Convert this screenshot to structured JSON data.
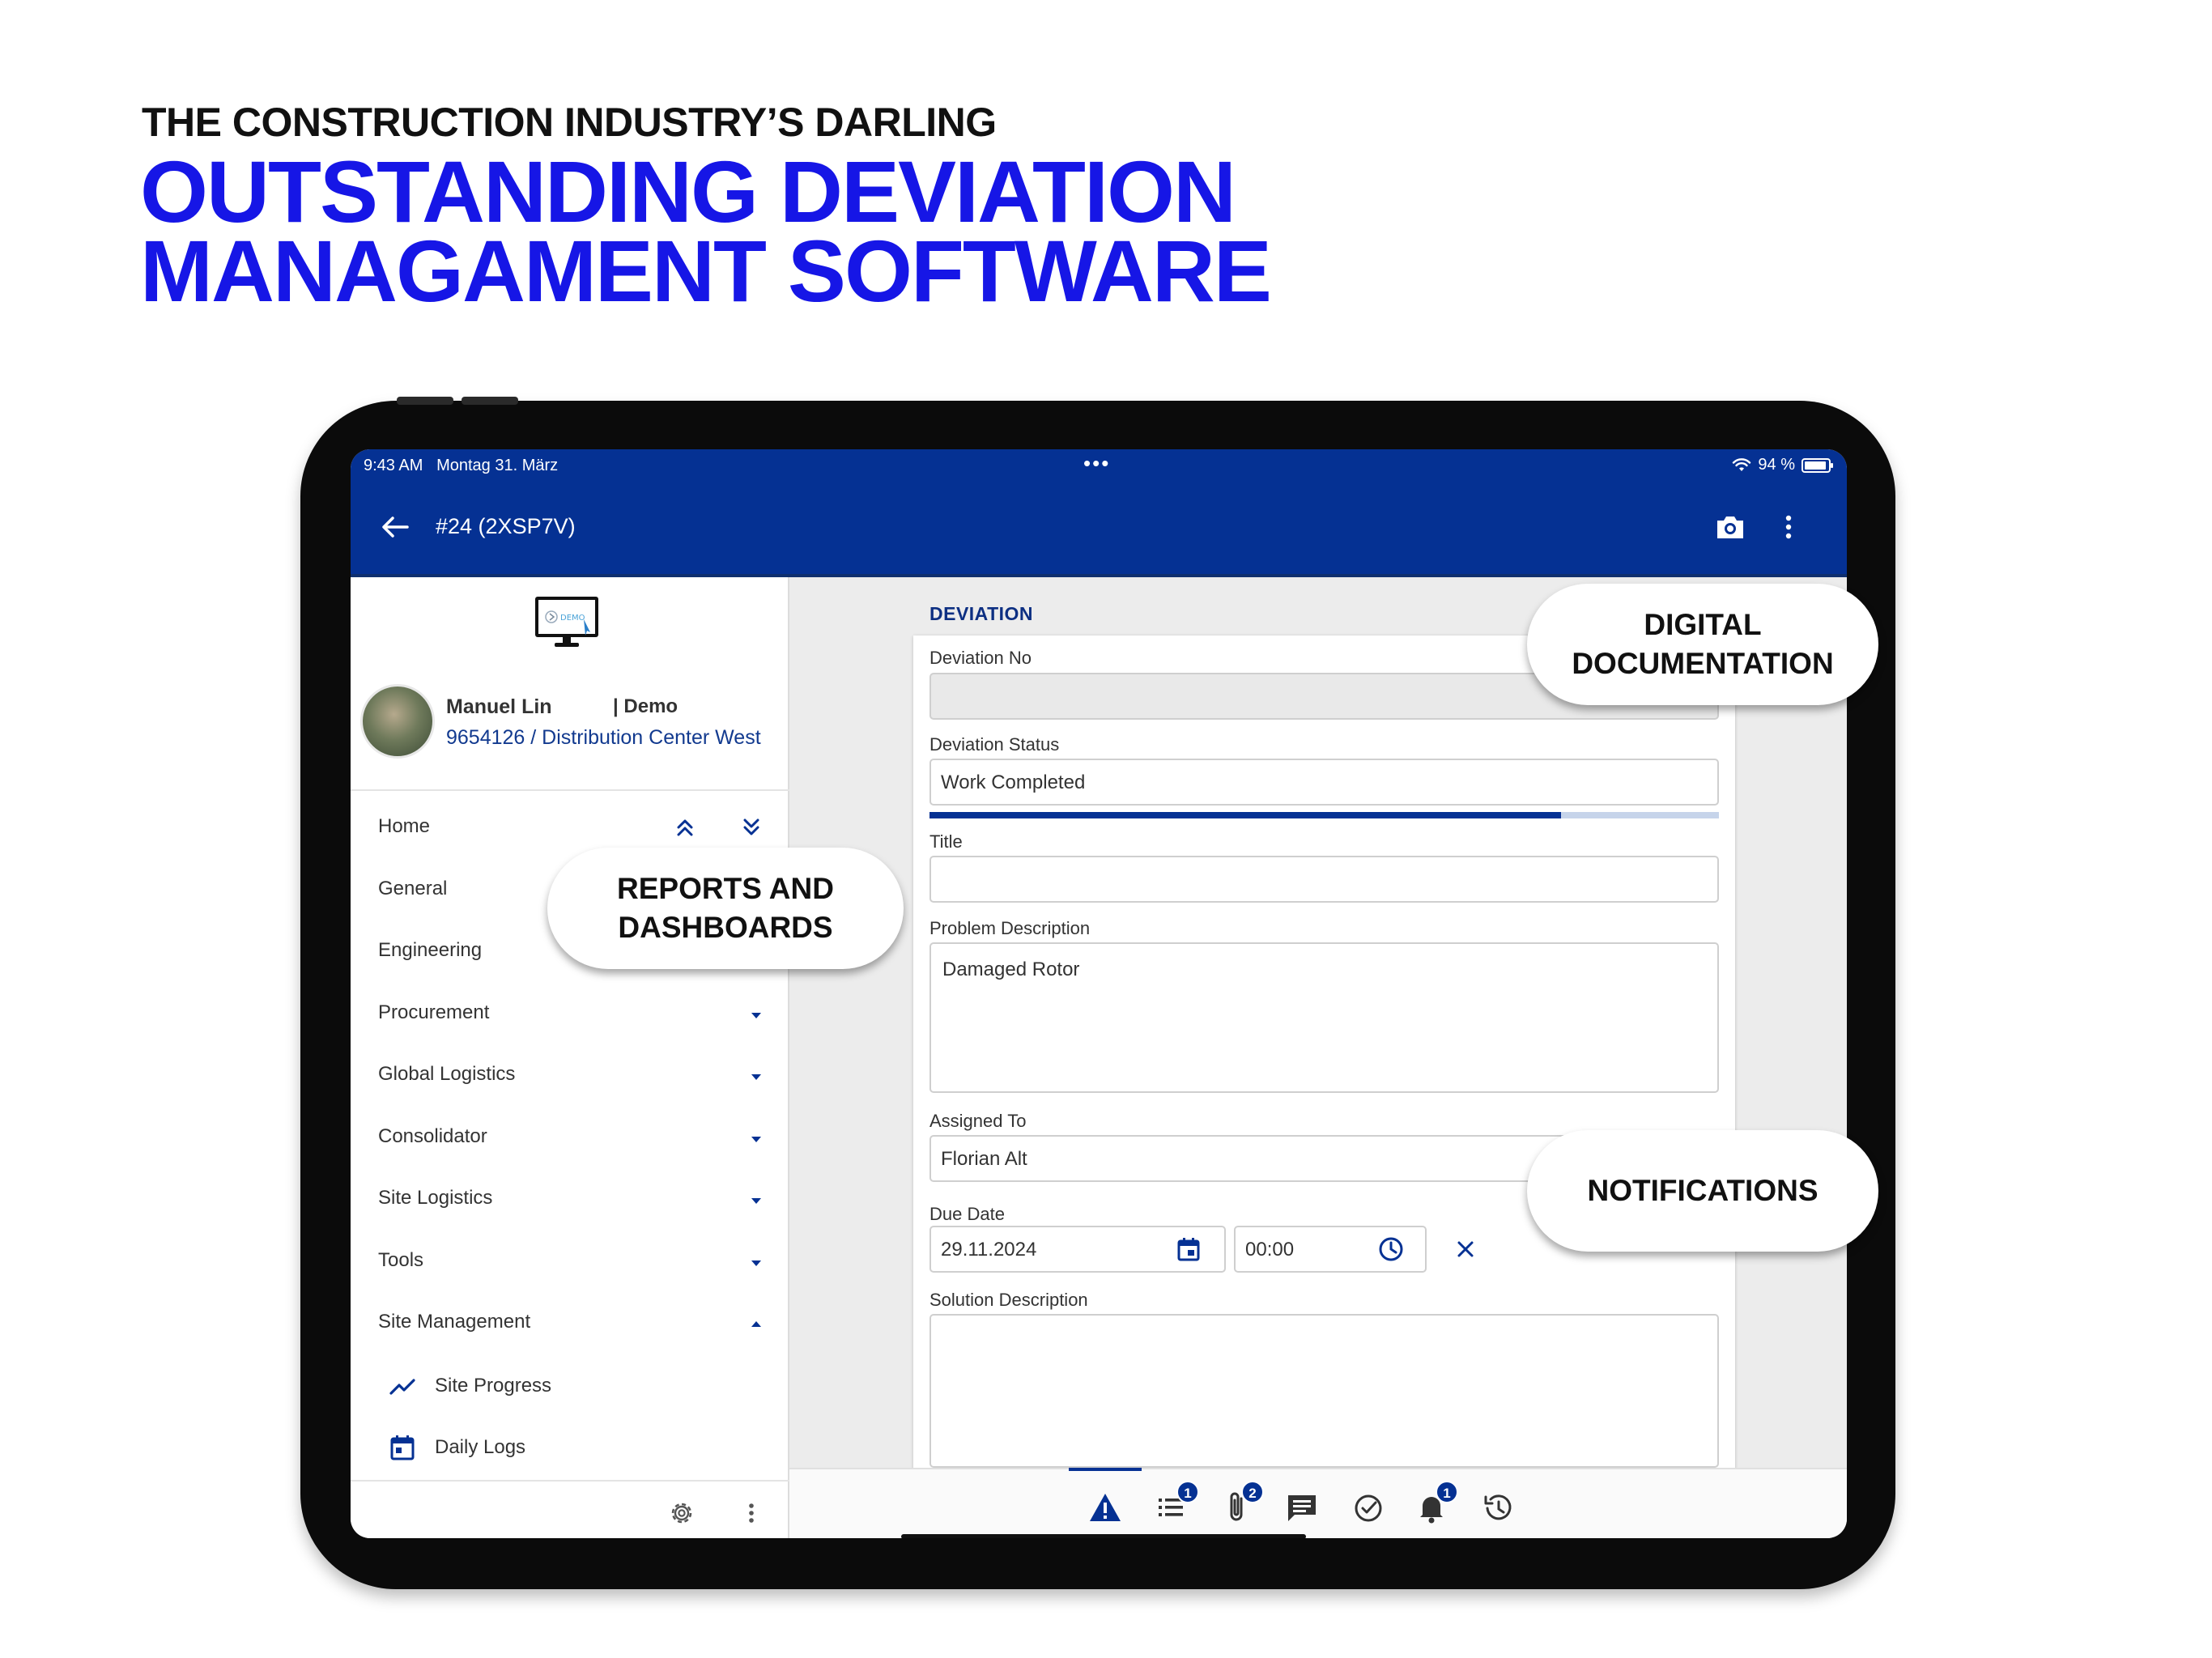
{
  "hero": {
    "eyebrow": "THE CONSTRUCTION INDUSTRY’S DARLING",
    "headline_line1": "OUTSTANDING DEVIATION",
    "headline_line2": "MANAGAMENT SOFTWARE"
  },
  "colors": {
    "brand_blue": "#053193",
    "headline_blue": "#1616e6"
  },
  "statusbar": {
    "time": "9:43 AM",
    "date": "Montag 31. März",
    "dots": "•••",
    "battery_label": "94 %"
  },
  "appbar": {
    "title": "#24 (2XSP7V)",
    "back_icon": "arrow-left-icon",
    "camera_icon": "camera-icon",
    "more_icon": "more-vert-icon"
  },
  "profile": {
    "name": "Manuel Lin",
    "tenant": "| Demo",
    "site": "9654126 / Distribution Center West",
    "logo_text": "DEMO"
  },
  "nav": {
    "home": "Home",
    "items": [
      {
        "label": "General"
      },
      {
        "label": "Engineering"
      },
      {
        "label": "Procurement"
      },
      {
        "label": "Global Logistics"
      },
      {
        "label": "Consolidator"
      },
      {
        "label": "Site Logistics"
      },
      {
        "label": "Tools"
      },
      {
        "label": "Site Management"
      }
    ],
    "sub_items": [
      {
        "label": "Site Progress",
        "icon": "trending-up-icon"
      },
      {
        "label": "Daily Logs",
        "icon": "calendar-icon"
      }
    ]
  },
  "form": {
    "section_title": "DEVIATION",
    "deviation_no_label": "Deviation No",
    "deviation_no_value": "",
    "status_label": "Deviation Status",
    "status_value": "Work Completed",
    "status_progress": 0.8,
    "title_label": "Title",
    "title_value": "",
    "problem_label": "Problem Description",
    "problem_value": "Damaged Rotor",
    "assigned_label": "Assigned To",
    "assigned_value": "Florian Alt",
    "due_label": "Due Date",
    "due_date": "29.11.2024",
    "due_time": "00:00",
    "solution_label": "Solution Description",
    "solution_value": ""
  },
  "tabs": [
    {
      "icon": "warning-icon",
      "badge": ""
    },
    {
      "icon": "checklist-icon",
      "badge": "1"
    },
    {
      "icon": "attachment-icon",
      "badge": "2"
    },
    {
      "icon": "comment-icon",
      "badge": ""
    },
    {
      "icon": "check-circle-icon",
      "badge": ""
    },
    {
      "icon": "bell-icon",
      "badge": "1"
    },
    {
      "icon": "history-icon",
      "badge": ""
    }
  ],
  "callouts": {
    "digital_line1": "DIGITAL",
    "digital_line2": "DOCUMENTATION",
    "reports_line1": "REPORTS AND",
    "reports_line2": "DASHBOARDS",
    "notifications": "NOTIFICATIONS"
  }
}
